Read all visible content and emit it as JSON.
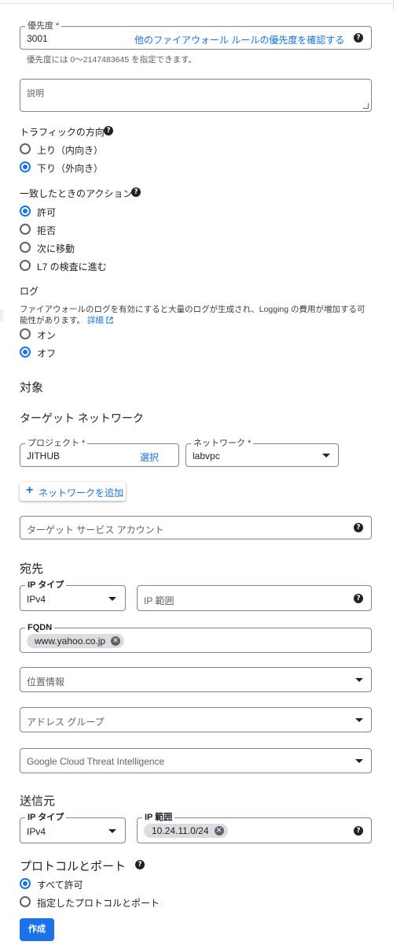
{
  "priority": {
    "label": "優先度 *",
    "value": "3001",
    "check_link": "他のファイアウォール ルールの優先度を確認する",
    "hint": "優先度には 0〜2147483645 を指定できます。"
  },
  "description": {
    "placeholder": "説明"
  },
  "traffic_direction": {
    "label": "トラフィックの方向",
    "options": [
      {
        "label": "上り（内向き）",
        "selected": false
      },
      {
        "label": "下り（外向き）",
        "selected": true
      }
    ]
  },
  "action_on_match": {
    "label": "一致したときのアクション",
    "options": [
      {
        "label": "許可",
        "selected": true
      },
      {
        "label": "拒否",
        "selected": false
      },
      {
        "label": "次に移動",
        "selected": false
      },
      {
        "label": "L7 の検査に進む",
        "selected": false
      }
    ]
  },
  "logs": {
    "label": "ログ",
    "description_line1": "ファイアウォールのログを有効にすると大量のログが生成され、Logging の費用が増加する可",
    "description_line2": "能性があります。",
    "details_link": "詳細",
    "options": [
      {
        "label": "オン",
        "selected": false
      },
      {
        "label": "オフ",
        "selected": true
      }
    ]
  },
  "targets": {
    "heading": "対象",
    "network_heading": "ターゲット ネットワーク",
    "project_label": "プロジェクト *",
    "project_value": "JITHUB",
    "select_link": "選択",
    "network_label": "ネットワーク *",
    "network_value": "labvpc",
    "add_network": "ネットワークを追加",
    "service_account_placeholder": "ターゲット サービス アカウント"
  },
  "destination": {
    "heading": "宛先",
    "ip_type_label": "IP タイプ",
    "ip_type_value": "IPv4",
    "ip_range_placeholder": "IP 範囲",
    "fqdn_label": "FQDN",
    "fqdn_chip": "www.yahoo.co.jp",
    "geolocation_placeholder": "位置情報",
    "address_group_placeholder": "アドレス グループ",
    "threat_intel_placeholder": "Google Cloud Threat Intelligence"
  },
  "source": {
    "heading": "送信元",
    "ip_type_label": "IP タイプ",
    "ip_type_value": "IPv4",
    "ip_range_label": "IP 範囲",
    "ip_range_chip": "10.24.11.0/24"
  },
  "protocols": {
    "heading": "プロトコルとポート",
    "options": [
      {
        "label": "すべて許可",
        "selected": true
      },
      {
        "label": "指定したプロトコルとポート",
        "selected": false
      }
    ]
  },
  "create_button": "作成",
  "colors": {
    "accent": "#1a73e8",
    "border": "#80868b",
    "text": "#202124"
  }
}
